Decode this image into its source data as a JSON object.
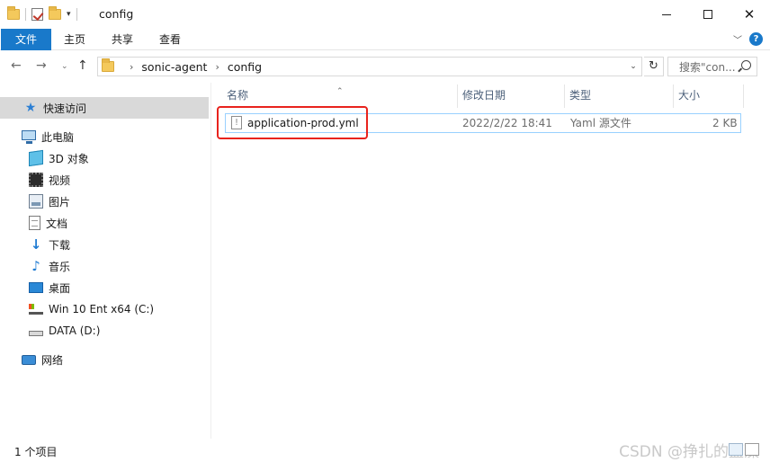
{
  "window": {
    "title": "config",
    "controls": {
      "minimize": "minimize-icon",
      "maximize": "maximize-icon",
      "close": "close-icon"
    }
  },
  "ribbon": {
    "tabs": [
      "文件",
      "主页",
      "共享",
      "查看"
    ]
  },
  "address": {
    "crumbs": [
      "sonic-agent",
      "config"
    ]
  },
  "search": {
    "placeholder": "搜索\"con..."
  },
  "navpane": {
    "items": [
      {
        "label": "快速访问",
        "icon": "star-icon",
        "selected": true
      },
      {
        "label": "此电脑",
        "icon": "computer-icon"
      },
      {
        "label": "3D 对象",
        "icon": "3d-objects-icon"
      },
      {
        "label": "视频",
        "icon": "video-icon"
      },
      {
        "label": "图片",
        "icon": "picture-icon"
      },
      {
        "label": "文档",
        "icon": "document-icon"
      },
      {
        "label": "下载",
        "icon": "download-icon"
      },
      {
        "label": "音乐",
        "icon": "music-icon"
      },
      {
        "label": "桌面",
        "icon": "desktop-icon"
      },
      {
        "label": "Win 10 Ent x64 (C:)",
        "icon": "drive-c-icon"
      },
      {
        "label": "DATA (D:)",
        "icon": "drive-d-icon"
      },
      {
        "label": "网络",
        "icon": "network-icon"
      }
    ]
  },
  "filelist": {
    "columns": [
      "名称",
      "修改日期",
      "类型",
      "大小"
    ],
    "rows": [
      {
        "name": "application-prod.yml",
        "modified": "2022/2/22 18:41",
        "type": "Yaml 源文件",
        "size": "2 KB"
      }
    ]
  },
  "status": {
    "item_count": "1 个项目"
  },
  "watermark": "CSDN @挣扎的蓝藻",
  "colors": {
    "accent": "#1979ca",
    "highlight": "#e8231d",
    "selection_border": "#99d1ff"
  }
}
